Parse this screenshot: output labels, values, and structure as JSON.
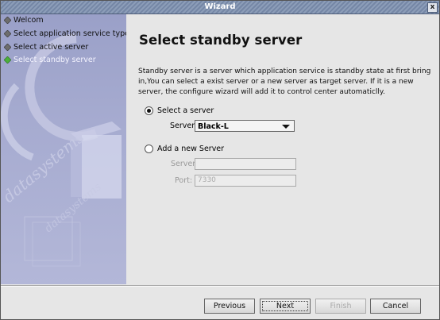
{
  "window": {
    "title": "Wizard",
    "close_glyph": "x"
  },
  "sidebar": {
    "steps": [
      {
        "label": "Welcom",
        "state": "done"
      },
      {
        "label": "Select application service type",
        "state": "done"
      },
      {
        "label": "Select active server",
        "state": "done"
      },
      {
        "label": "Select standby server",
        "state": "current"
      }
    ],
    "watermark": "datasystems"
  },
  "main": {
    "title": "Select standby server",
    "description": "Standby server is a server which application service is standby state at first bring in,You can select a exist server or a new server as target server. If it is a new server, the configure wizard will add it to control center automaticlly.",
    "option_existing": {
      "label": "Select a server",
      "selected": true
    },
    "server_select": {
      "label": "Server:",
      "value": "Black-L"
    },
    "option_new": {
      "label": "Add a new Server",
      "selected": false
    },
    "new_server_field": {
      "label": "Server:",
      "value": ""
    },
    "port_field": {
      "label": "Port:",
      "value": "7330"
    }
  },
  "buttons": {
    "previous": "Previous",
    "next": "Next",
    "finish": "Finish",
    "cancel": "Cancel"
  },
  "colors": {
    "titlebar": "#7f91ae",
    "sidebar": "#a6abd0",
    "current_step_bullet": "#4caf3c"
  }
}
